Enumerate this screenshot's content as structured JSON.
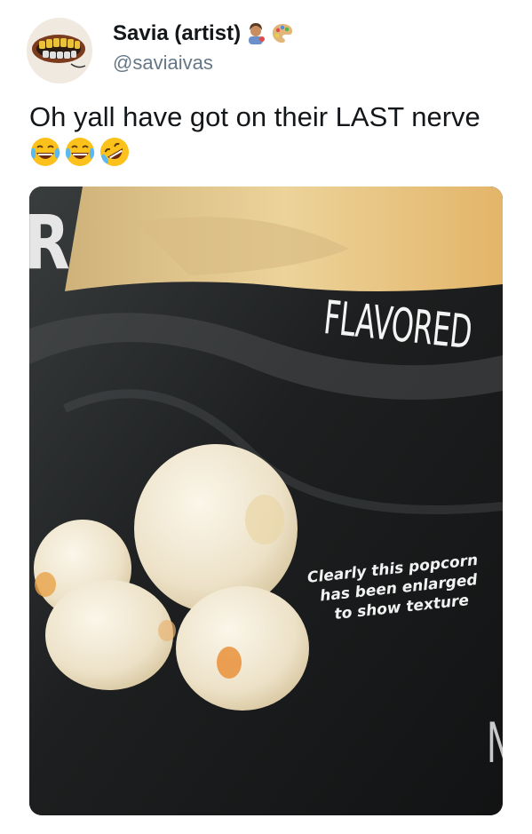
{
  "tweet": {
    "author": {
      "display_name": "Savia (artist)",
      "name_emojis": [
        "woman-artist-emoji",
        "palette-emoji"
      ],
      "handle": "@saviaivas",
      "avatar": "avatar-image"
    },
    "text": "Oh yall have got on their LAST nerve",
    "text_emojis": [
      "face-with-tears-of-joy",
      "face-with-tears-of-joy",
      "rolling-on-floor-laughing"
    ]
  },
  "media": {
    "package": {
      "brand_fragment": "R",
      "flavor_label": "FLAVORED",
      "edge_letter": "N",
      "caption_lines": [
        "Clearly this popcorn",
        "has been enlarged",
        "to show texture"
      ]
    },
    "colors": {
      "bag": "#1c1e1f",
      "gold": "#e7c98a",
      "popcorn": "#f2ead8"
    }
  }
}
